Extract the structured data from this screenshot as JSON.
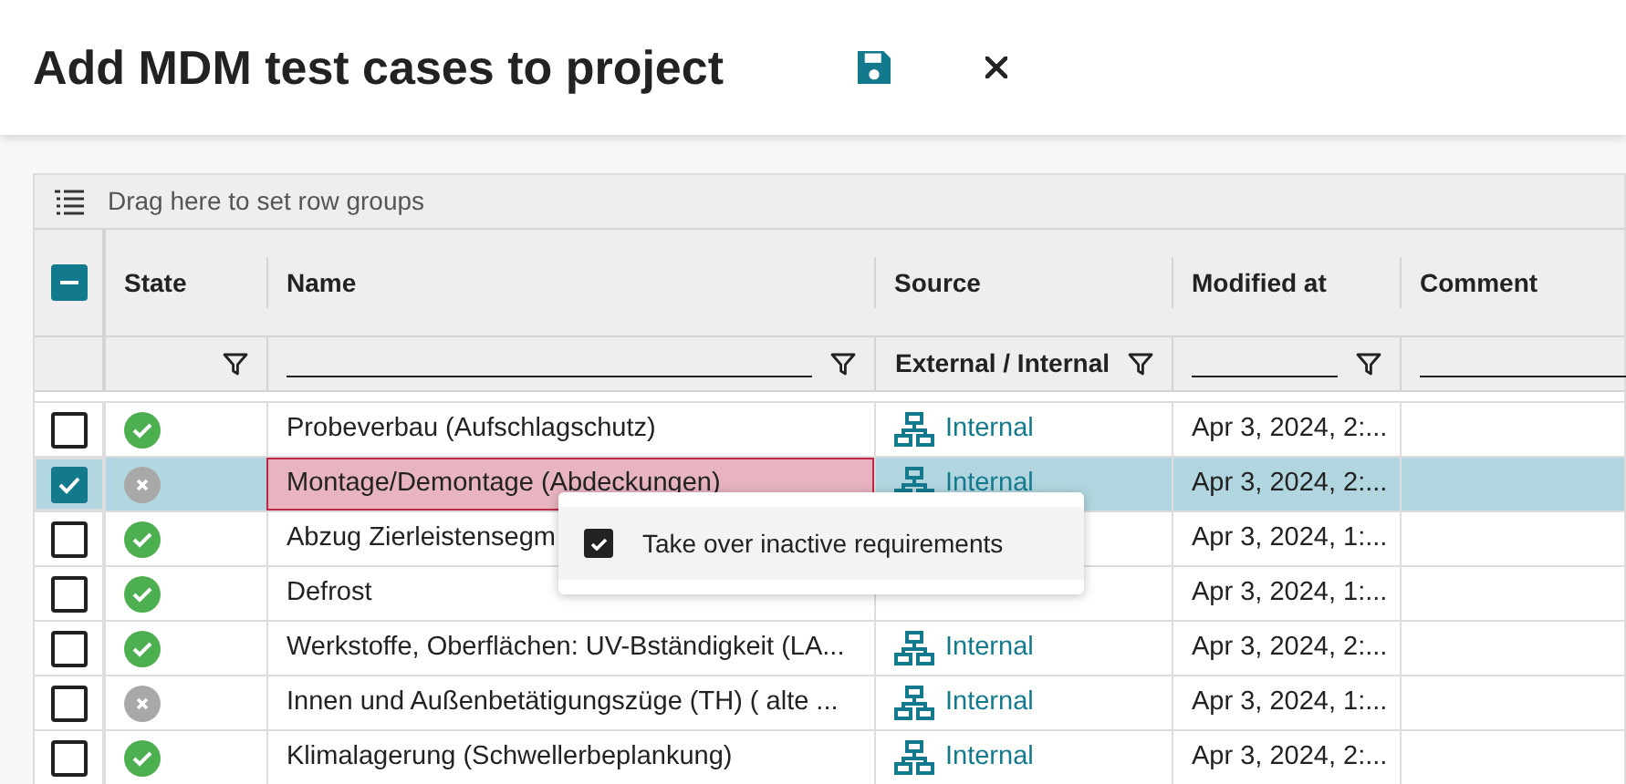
{
  "window": {
    "title": "Add MDM test cases to project"
  },
  "grid": {
    "group_bar": "Drag here to set row groups",
    "select_all": {
      "indeterminate": true
    },
    "columns": [
      {
        "label": "State"
      },
      {
        "label": "Name"
      },
      {
        "label": "Source",
        "filter": "External / Internal"
      },
      {
        "label": "Modified at"
      },
      {
        "label": "Comment"
      }
    ],
    "rows": [
      {
        "selected": false,
        "focused": false,
        "active": true,
        "name": "Probeverbau (Aufschlagschutz)",
        "source": "Internal",
        "modified": "Apr 3, 2024, 2:..."
      },
      {
        "selected": true,
        "focused": true,
        "active": false,
        "name": "Montage/Demontage (Abdeckungen)",
        "source": "Internal",
        "modified": "Apr 3, 2024, 2:..."
      },
      {
        "selected": false,
        "focused": false,
        "active": true,
        "name": "Abzug Zierleistensegm",
        "modified": "Apr 3, 2024, 1:..."
      },
      {
        "selected": false,
        "focused": false,
        "active": true,
        "name": "Defrost",
        "modified": "Apr 3, 2024, 1:..."
      },
      {
        "selected": false,
        "focused": false,
        "active": true,
        "name": "Werkstoffe, Oberflächen: UV-Bständigkeit (LA...",
        "source": "Internal",
        "modified": "Apr 3, 2024, 2:..."
      },
      {
        "selected": false,
        "focused": false,
        "active": false,
        "name": "Innen und Außenbetätigungszüge (TH) ( alte ...",
        "source": "Internal",
        "modified": "Apr 3, 2024, 1:..."
      },
      {
        "selected": false,
        "focused": false,
        "active": true,
        "name": "Klimalagerung (Schwellerbeplankung)",
        "source": "Internal",
        "modified": "Apr 3, 2024, 2:..."
      }
    ]
  },
  "popup": {
    "label": "Take over inactive requirements",
    "checked": true
  }
}
